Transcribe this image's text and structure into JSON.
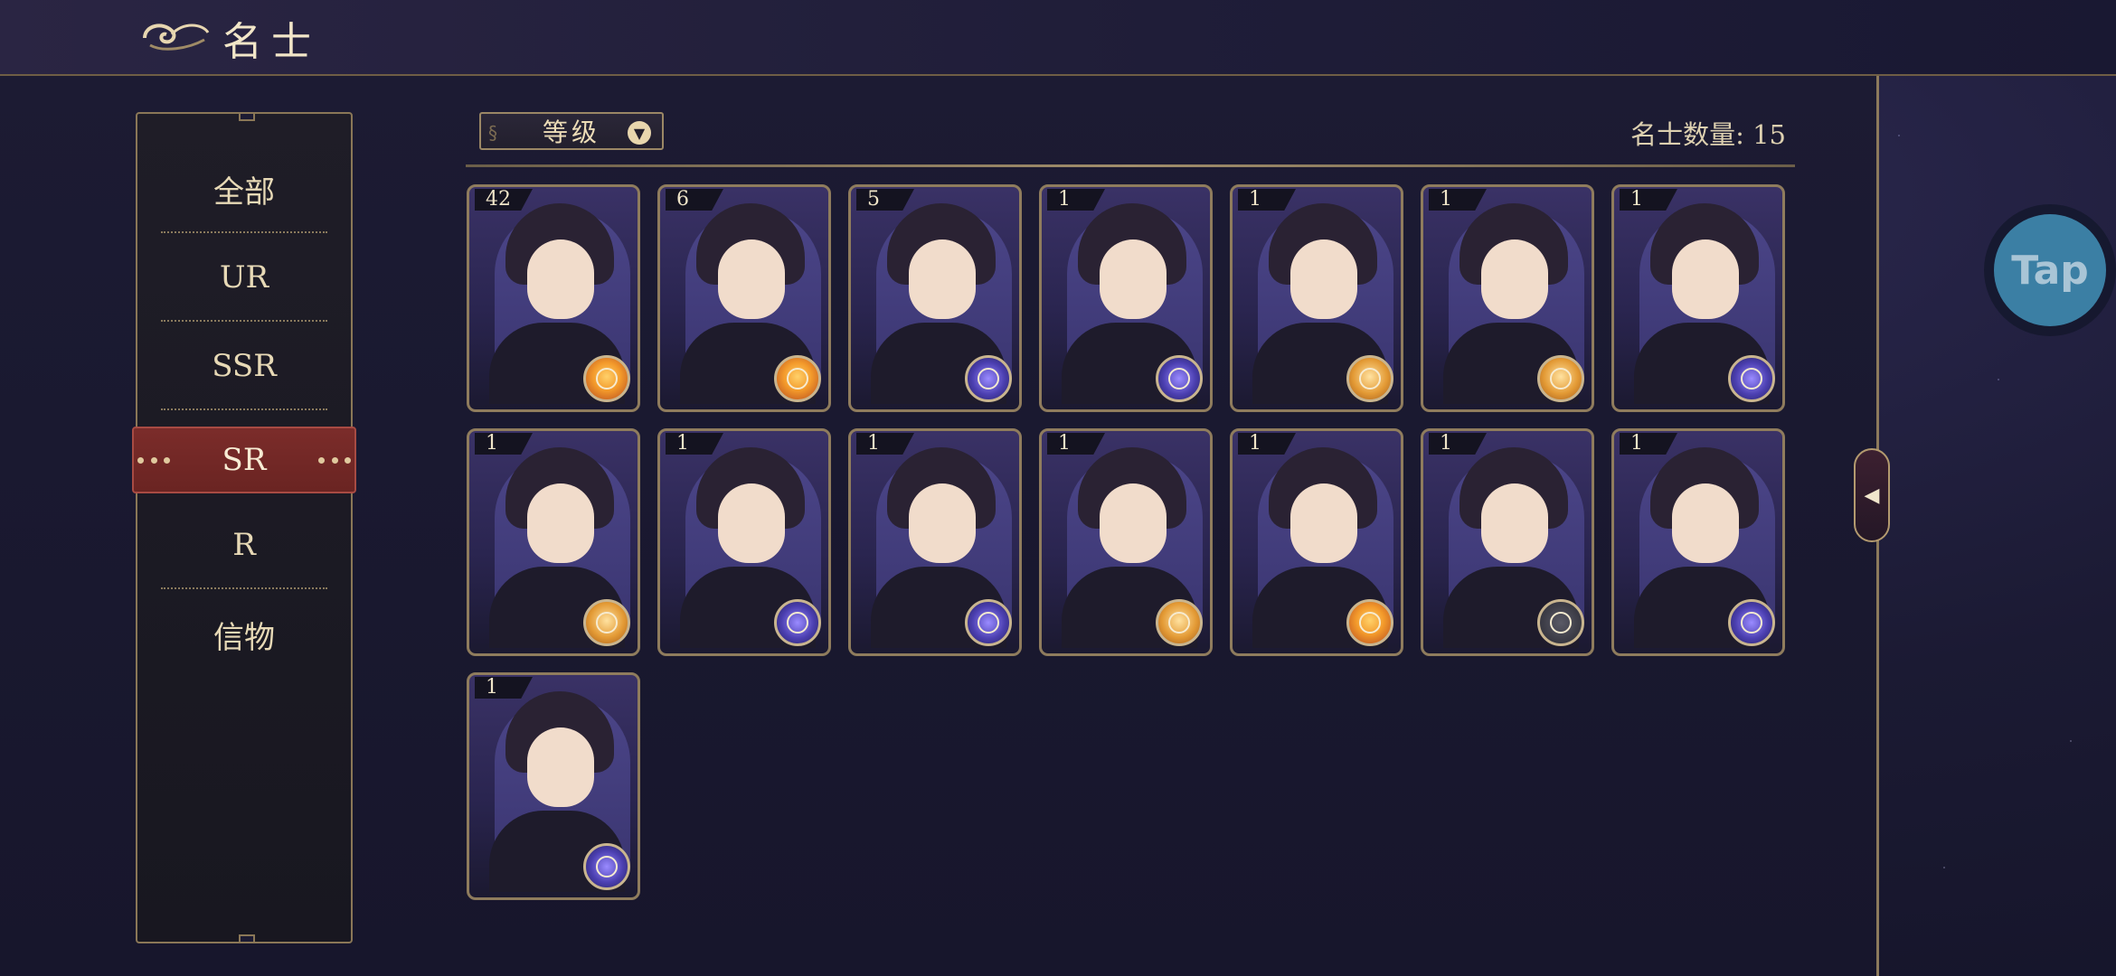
{
  "header": {
    "title": "名士"
  },
  "sidebar": {
    "items": [
      {
        "label": "全部"
      },
      {
        "label": "UR"
      },
      {
        "label": "SSR"
      },
      {
        "label": "SR",
        "active": true
      },
      {
        "label": "R"
      },
      {
        "label": "信物"
      }
    ]
  },
  "toolbar": {
    "sort_label": "等级",
    "count_text": "名士数量: 15"
  },
  "cards": [
    {
      "level": "42",
      "badge": "sun"
    },
    {
      "level": "6",
      "badge": "sun"
    },
    {
      "level": "5",
      "badge": "moon"
    },
    {
      "level": "1",
      "badge": "moon"
    },
    {
      "level": "1",
      "badge": "orange"
    },
    {
      "level": "1",
      "badge": "orange"
    },
    {
      "level": "1",
      "badge": "moon"
    },
    {
      "level": "1",
      "badge": "orange"
    },
    {
      "level": "1",
      "badge": "moon"
    },
    {
      "level": "1",
      "badge": "moon"
    },
    {
      "level": "1",
      "badge": "orange"
    },
    {
      "level": "1",
      "badge": "sun"
    },
    {
      "level": "1",
      "badge": "star"
    },
    {
      "level": "1",
      "badge": "moon"
    },
    {
      "level": "1",
      "badge": "moon"
    }
  ],
  "overlay": {
    "tap_label": "Tap"
  },
  "colors": {
    "accent_gold": "#8f7c5d",
    "active_tab": "#7b2c2a",
    "tap_blue": "#3b7fa4"
  }
}
